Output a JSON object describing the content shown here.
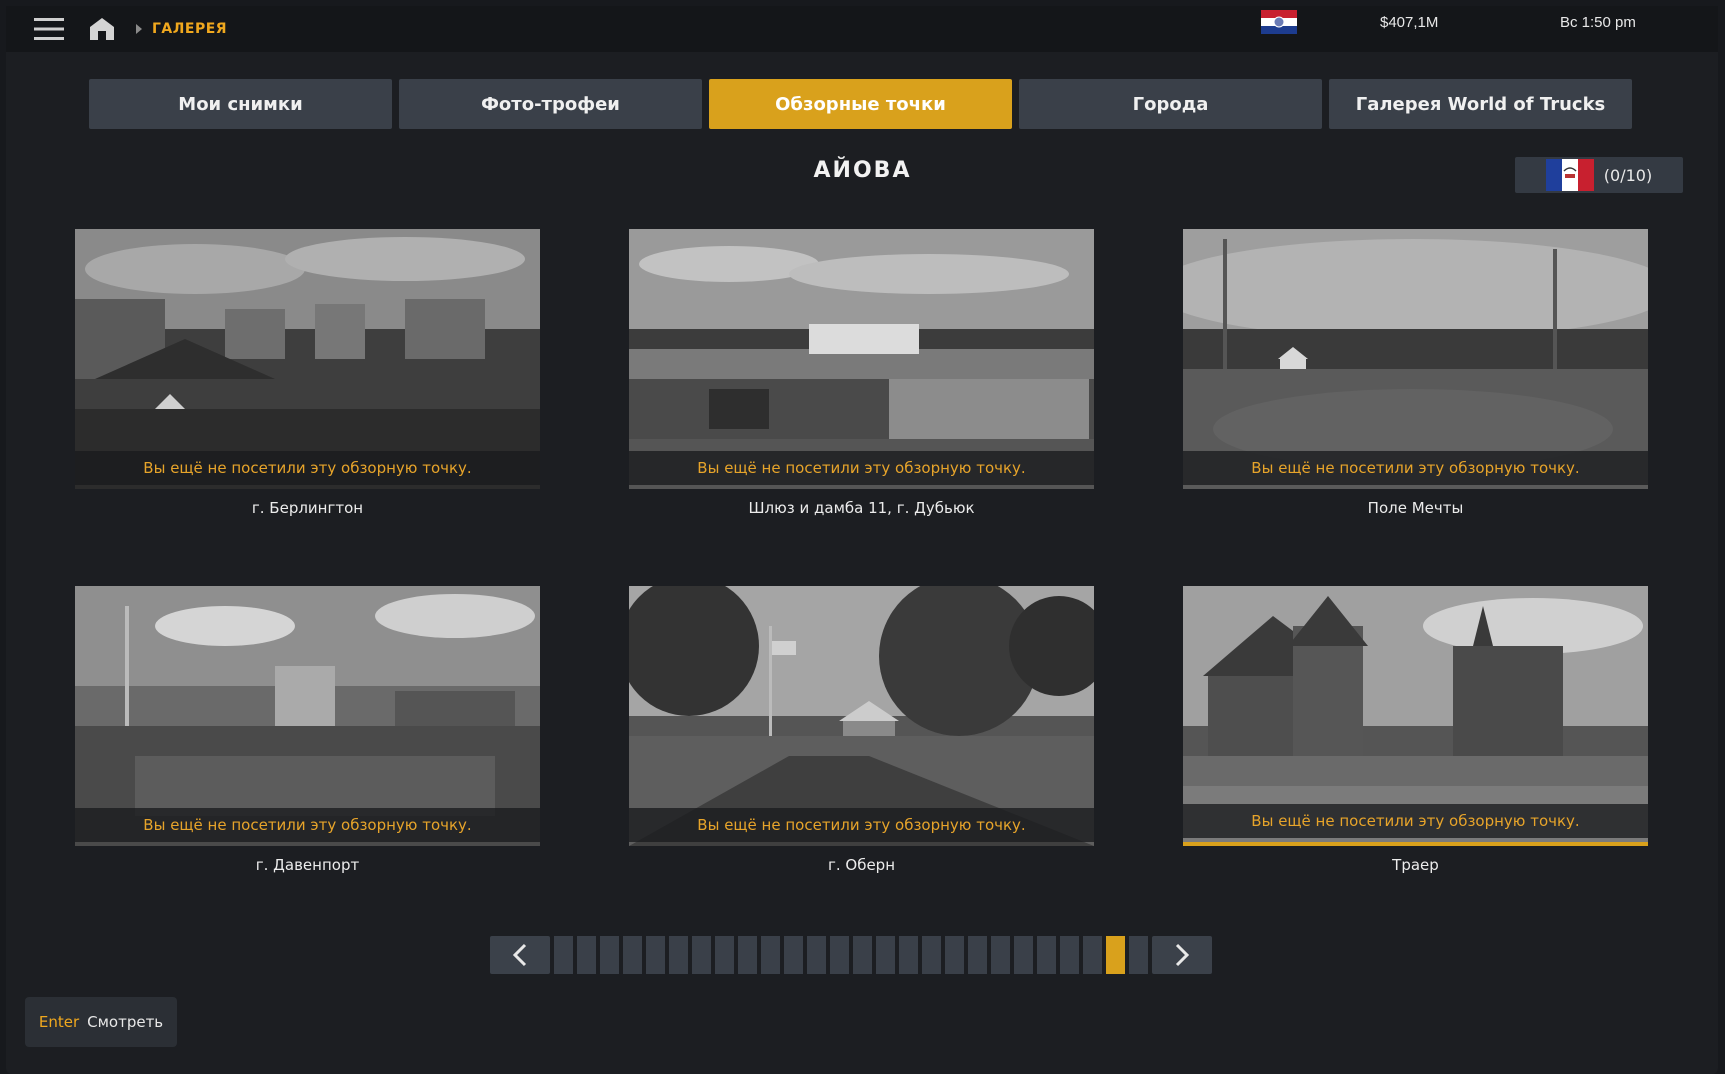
{
  "topbar": {
    "breadcrumb": "ГАЛЕРЕЯ",
    "money": "$407,1M",
    "clock": "Вс 1:50 pm"
  },
  "tabs": [
    {
      "label": "Мои снимки",
      "active": false
    },
    {
      "label": "Фото-трофеи",
      "active": false
    },
    {
      "label": "Обзорные точки",
      "active": true
    },
    {
      "label": "Города",
      "active": false
    },
    {
      "label": "Галерея World of Trucks",
      "active": false
    }
  ],
  "state": {
    "title": "АЙОВА",
    "progress": "(0/10)"
  },
  "cards": [
    {
      "caption": "г. Берлингтон",
      "note": "Вы ещё не посетили эту обзорную точку."
    },
    {
      "caption": "Шлюз и дамба 11, г. Дубьюк",
      "note": "Вы ещё не посетили эту обзорную точку."
    },
    {
      "caption": "Поле Мечты",
      "note": "Вы ещё не посетили эту обзорную точку."
    },
    {
      "caption": "г. Давенпорт",
      "note": "Вы ещё не посетили эту обзорную точку."
    },
    {
      "caption": "г. Оберн",
      "note": "Вы ещё не посетили эту обзорную точку."
    },
    {
      "caption": "Траер",
      "note": "Вы ещё не посетили эту обзорную точку."
    }
  ],
  "pager": {
    "total_pages": 26,
    "current_page": 25
  },
  "hint": {
    "key": "Enter",
    "action": "Смотреть"
  },
  "colors": {
    "accent": "#d9a11c",
    "tab_bg": "#3a4049",
    "note_text": "#e7a42a"
  },
  "icons": [
    "menu-icon",
    "home-icon",
    "missouri-flag-icon",
    "iowa-flag-icon",
    "chevron-left-icon",
    "chevron-right-icon"
  ]
}
